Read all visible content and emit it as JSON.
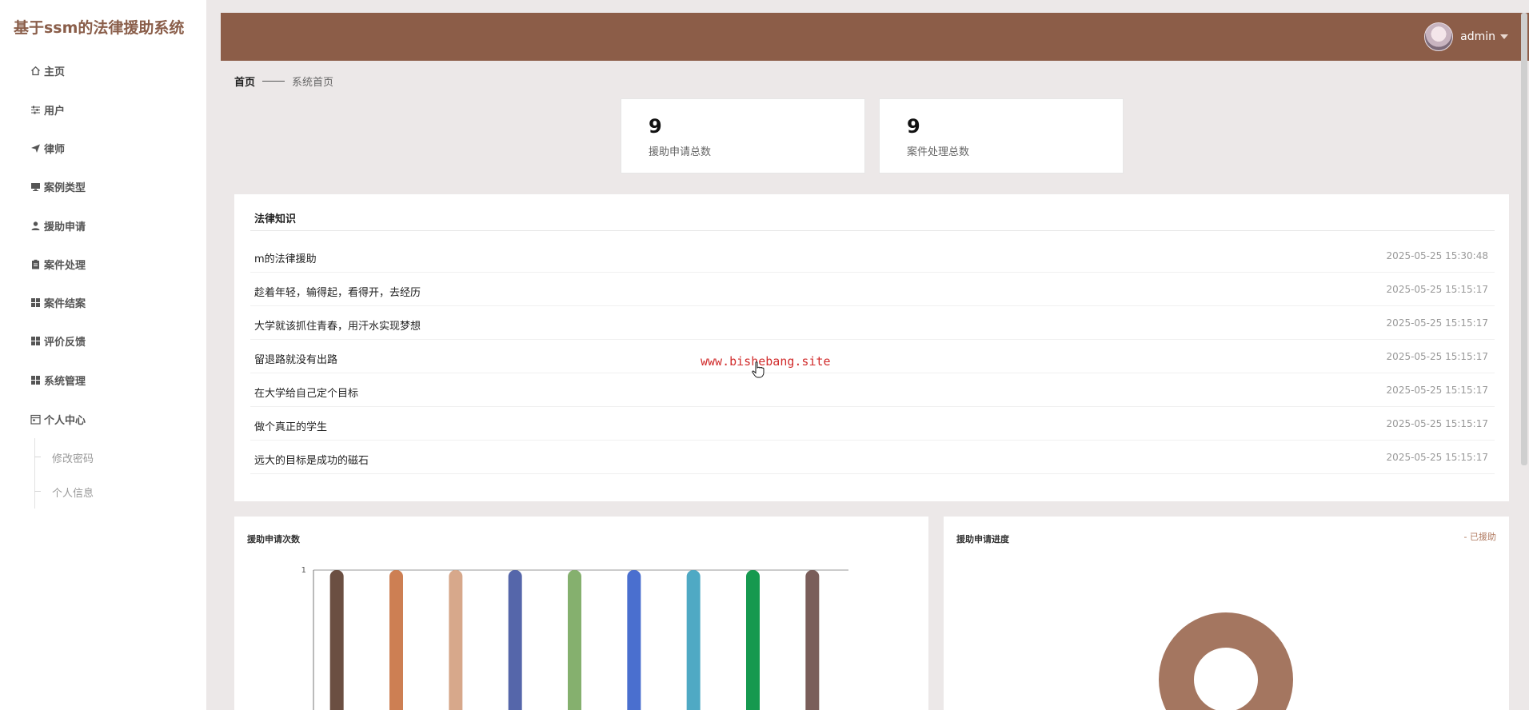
{
  "app": {
    "title": "基于ssm的法律援助系统"
  },
  "sidebar": {
    "items": [
      {
        "label": "主页",
        "icon": "home-icon"
      },
      {
        "label": "用户",
        "icon": "sliders-icon"
      },
      {
        "label": "律师",
        "icon": "send-icon"
      },
      {
        "label": "案例类型",
        "icon": "monitor-icon"
      },
      {
        "label": "援助申请",
        "icon": "user-icon"
      },
      {
        "label": "案件处理",
        "icon": "clipboard-icon"
      },
      {
        "label": "案件结案",
        "icon": "grid-icon"
      },
      {
        "label": "评价反馈",
        "icon": "grid-icon"
      },
      {
        "label": "系统管理",
        "icon": "grid-icon"
      },
      {
        "label": "个人中心",
        "icon": "calendar-icon"
      }
    ],
    "subitems": [
      {
        "label": "修改密码"
      },
      {
        "label": "个人信息"
      }
    ]
  },
  "header": {
    "username": "admin"
  },
  "breadcrumb": {
    "home": "首页",
    "current": "系统首页"
  },
  "stats": [
    {
      "value": "9",
      "label": "援助申请总数"
    },
    {
      "value": "9",
      "label": "案件处理总数"
    }
  ],
  "knowledge": {
    "title": "法律知识",
    "items": [
      {
        "title": "m的法律援助",
        "date": "2025-05-25 15:30:48"
      },
      {
        "title": "趁着年轻，输得起，看得开，去经历",
        "date": "2025-05-25 15:15:17"
      },
      {
        "title": "大学就该抓住青春，用汗水实现梦想",
        "date": "2025-05-25 15:15:17"
      },
      {
        "title": "留退路就没有出路",
        "date": "2025-05-25 15:15:17"
      },
      {
        "title": "在大学给自己定个目标",
        "date": "2025-05-25 15:15:17"
      },
      {
        "title": "做个真正的学生",
        "date": "2025-05-25 15:15:17"
      },
      {
        "title": "远大的目标是成功的磁石",
        "date": "2025-05-25 15:15:17"
      }
    ]
  },
  "watermark": "www.bishebang.site",
  "chart_data": [
    {
      "type": "bar",
      "title": "援助申请次数",
      "categories": [
        "",
        "",
        "",
        "",
        "",
        "",
        "",
        "",
        ""
      ],
      "values": [
        1,
        1,
        1,
        1,
        1,
        1,
        1,
        1,
        1
      ],
      "colors": [
        "#6b4f42",
        "#cd7f53",
        "#d7a88b",
        "#5566aa",
        "#85b06e",
        "#4a6fcf",
        "#4fa9c4",
        "#16994f",
        "#7a5e5a"
      ],
      "ylim": [
        0,
        1
      ],
      "yticks": [
        "1"
      ],
      "grid": true
    },
    {
      "type": "pie",
      "title": "援助申请进度",
      "legend": [
        "已援助"
      ],
      "values": [
        1
      ],
      "colors": [
        "#a47660"
      ],
      "legend_placement": "top-right"
    }
  ]
}
